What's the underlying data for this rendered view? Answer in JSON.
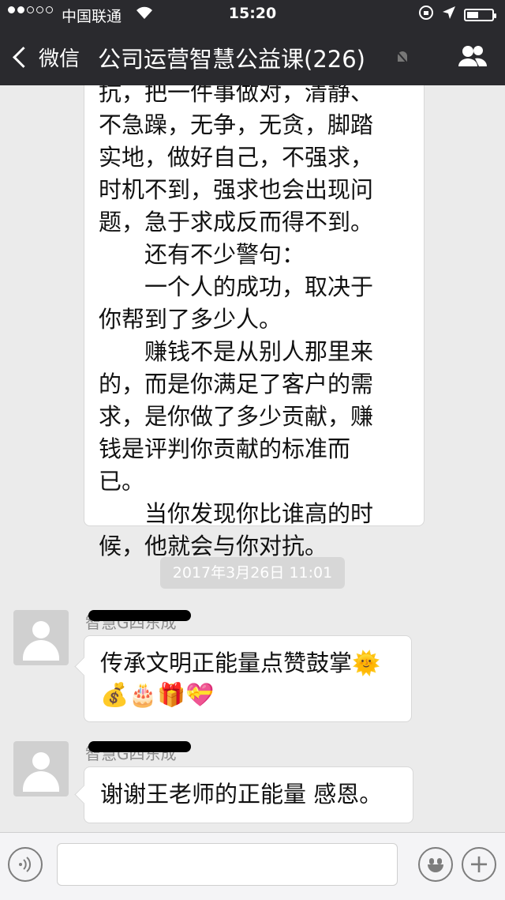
{
  "status_bar": {
    "carrier": "中国联通",
    "time": "15:20",
    "battery_level": 0.45
  },
  "nav": {
    "back_label": "微信",
    "title": "公司运营智慧公益课(226)"
  },
  "long_message": {
    "lines": [
      "抗，把一件事做对，清静、",
      "不急躁，无争，无贪，脚踏",
      "实地，做好自己，不强求，",
      "时机不到，强求也会出现问",
      "题，急于求成反而得不到。",
      "　　还有不少警句：",
      "　　一个人的成功，取决于",
      "你帮到了多少人。",
      "　　赚钱不是从别人那里来",
      "的，而是你满足了客户的需",
      "求，是你做了多少贡献，赚",
      "钱是评判你贡献的标准而",
      "已。",
      "　　当你发现你比谁高的时",
      "候，他就会与你对抗。"
    ]
  },
  "timestamp": "2017年3月26日 11:01",
  "messages": [
    {
      "sender": "智慧G四东成",
      "text_line1": "传承文明正能量点赞鼓掌🌞",
      "text_line2": "💰🎂🎁💝"
    },
    {
      "sender": "智慧G四东成",
      "text": "谢谢王老师的正能量 感恩。"
    }
  ],
  "icons": {
    "back": "chevron-left-icon",
    "mute": "bell-muted-icon",
    "members": "people-icon",
    "voice": "voice-icon",
    "emoji": "emoji-icon",
    "more": "plus-icon"
  },
  "colors": {
    "topbar": "#2a2a2e",
    "background": "#ebebeb",
    "bubble": "#ffffff"
  }
}
